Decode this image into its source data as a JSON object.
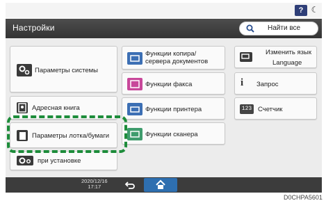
{
  "top": {
    "help_label": "?",
    "moon_icon": "moon-icon"
  },
  "header": {
    "title": "Настройки",
    "search_label": "Найти все"
  },
  "tiles": {
    "system": "Параметры системы",
    "copy_server": "Функции копира/\nсервера документов",
    "language": "Изменить язык",
    "language_sub": "Language",
    "fax": "Функции факса",
    "query": "Запрос",
    "address_book": "Адресная книга",
    "printer": "Функции принтера",
    "counter": "Счетчик",
    "counter_icon_text": "123",
    "tray": "Параметры лотка/бумаги",
    "scanner": "Функции сканера",
    "install": "при установке"
  },
  "bottom": {
    "date": "2020/12/16",
    "time": "17:17"
  },
  "caption": "D0CHPA5601",
  "colors": {
    "highlight": "#1d8c3a",
    "home": "#2e6fb0",
    "header": "#3f3f3f"
  }
}
